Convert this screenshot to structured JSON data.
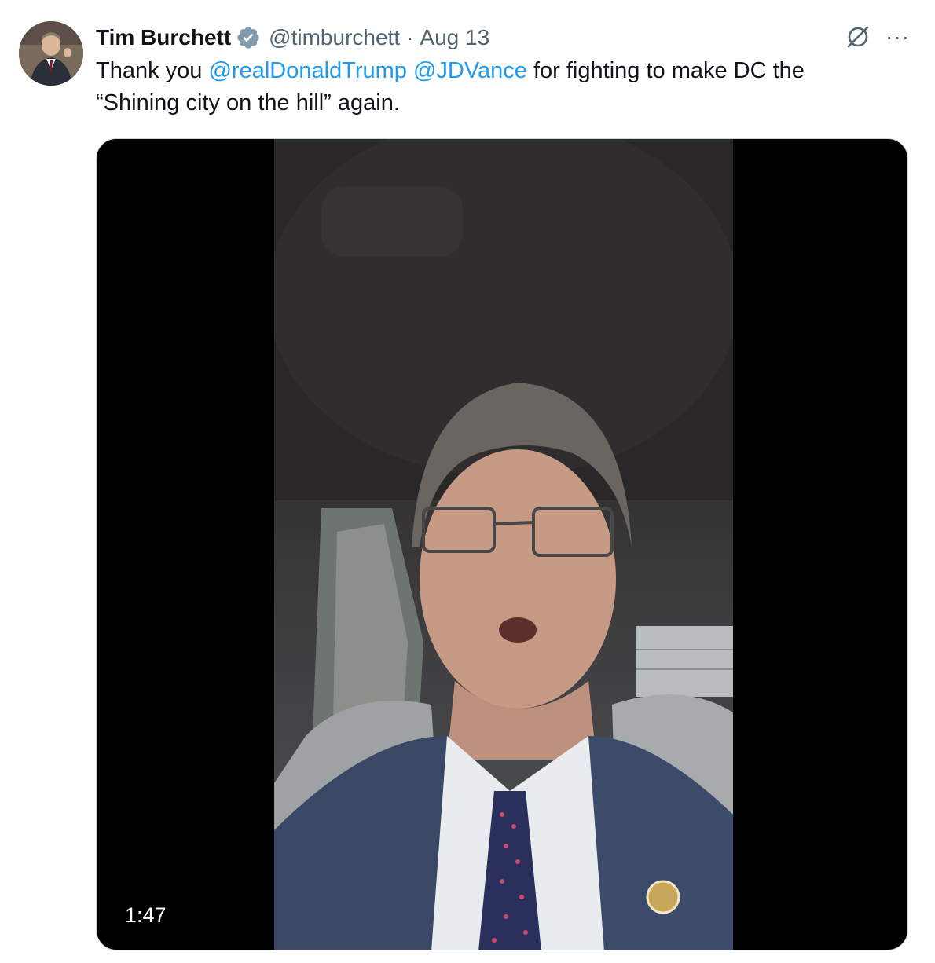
{
  "author": {
    "display_name": "Tim Burchett",
    "handle": "@timburchett",
    "separator": "·",
    "date": "Aug 13",
    "verified_icon": "verified-badge-gray"
  },
  "tweet": {
    "text_before": "Thank you ",
    "mention_1": "@realDonaldTrump",
    "space": " ",
    "mention_2": "@JDVance",
    "text_after_line1": " for fighting to make DC the",
    "text_line2": "“Shining city on the hill” again."
  },
  "media": {
    "type": "video",
    "duration": "1:47"
  },
  "actions": {
    "grok_icon": "grok-icon",
    "more_label": "···"
  },
  "colors": {
    "mention": "#1d9bf0",
    "secondary_text": "#536471",
    "primary_text": "#0f1419"
  }
}
